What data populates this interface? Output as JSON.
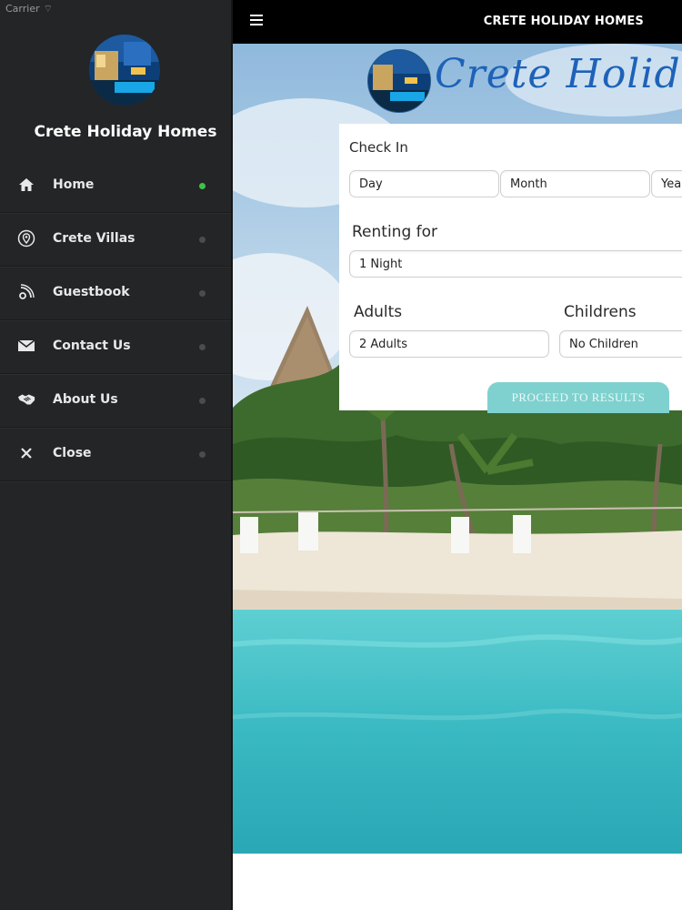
{
  "status_bar": {
    "carrier": "Carrier"
  },
  "sidebar": {
    "title": "Crete Holiday Homes",
    "items": [
      {
        "label": "Home",
        "icon": "home-icon",
        "active": true
      },
      {
        "label": "Crete Villas",
        "icon": "location-pin-icon",
        "active": false
      },
      {
        "label": "Guestbook",
        "icon": "feed-icon",
        "active": false
      },
      {
        "label": "Contact Us",
        "icon": "envelope-icon",
        "active": false
      },
      {
        "label": "About Us",
        "icon": "handshake-icon",
        "active": false
      },
      {
        "label": "Close",
        "icon": "close-icon",
        "active": false
      }
    ]
  },
  "topbar": {
    "title": "CRETE HOLIDAY HOMES"
  },
  "hero": {
    "logo_text": "Crete Holiday Homes"
  },
  "booking": {
    "check_in_label": "Check In",
    "day": "Day",
    "month": "Month",
    "year": "Year",
    "renting_label": "Renting for",
    "renting_value": "1 Night",
    "adults_label": "Adults",
    "adults_value": "2 Adults",
    "children_label": "Childrens",
    "children_value": "No Children",
    "proceed_label": "PROCEED TO RESULTS"
  },
  "colors": {
    "sidebar_bg": "#232526",
    "active_dot": "#3ec24a",
    "topbar_bg": "#000000",
    "proceed_bg": "#7fd1cf",
    "logo_text": "#1e62b8"
  }
}
